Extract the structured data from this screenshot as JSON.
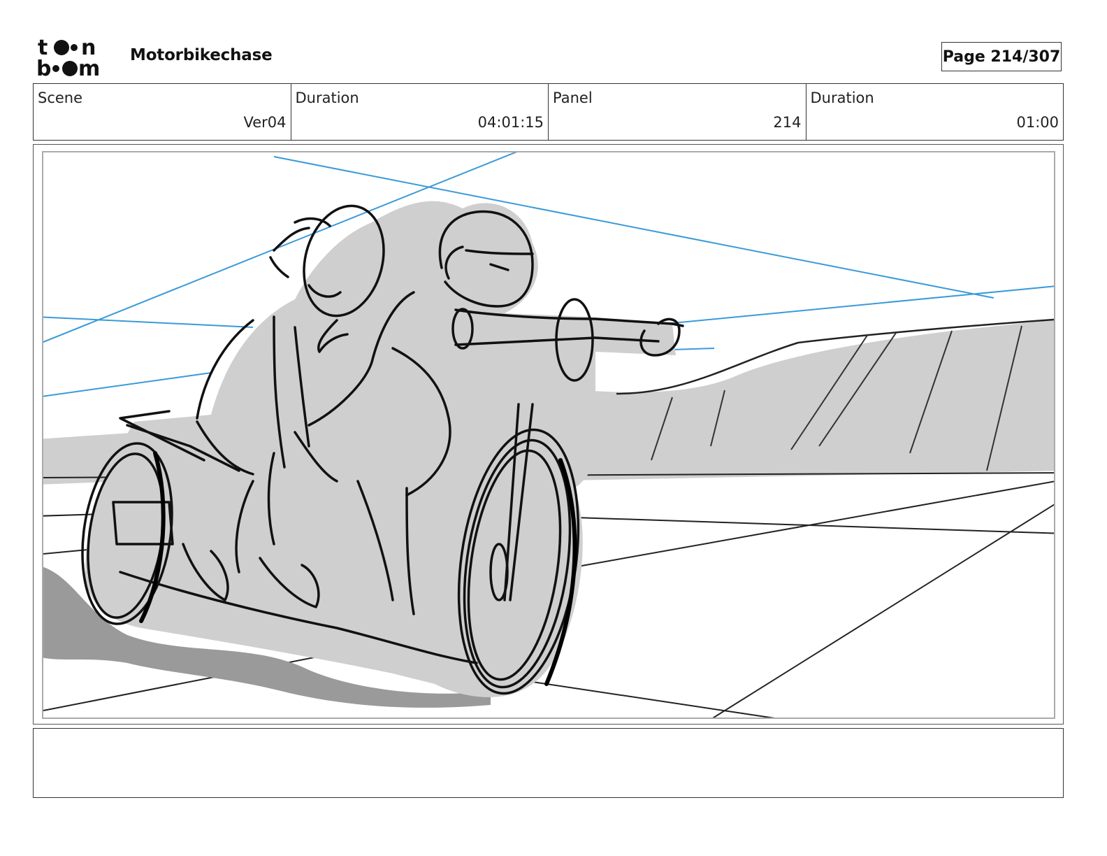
{
  "header": {
    "logo_text": "toon boom",
    "project_title": "Motorbikechase",
    "page_label": "Page 214/307"
  },
  "info": {
    "scene_label": "Scene",
    "scene_value": "Ver04",
    "scene_duration_label": "Duration",
    "scene_duration_value": "04:01:15",
    "panel_label": "Panel",
    "panel_value": "214",
    "panel_duration_label": "Duration",
    "panel_duration_value": "01:00"
  },
  "panel": {
    "image_name": "motorbike-sketch",
    "colors": {
      "sketch_line": "#111111",
      "fill_gray": "#cfcfcf",
      "shadow_gray": "#9a9a9a",
      "guide_blue": "#3a9ad9"
    }
  },
  "notes": {
    "text": ""
  }
}
